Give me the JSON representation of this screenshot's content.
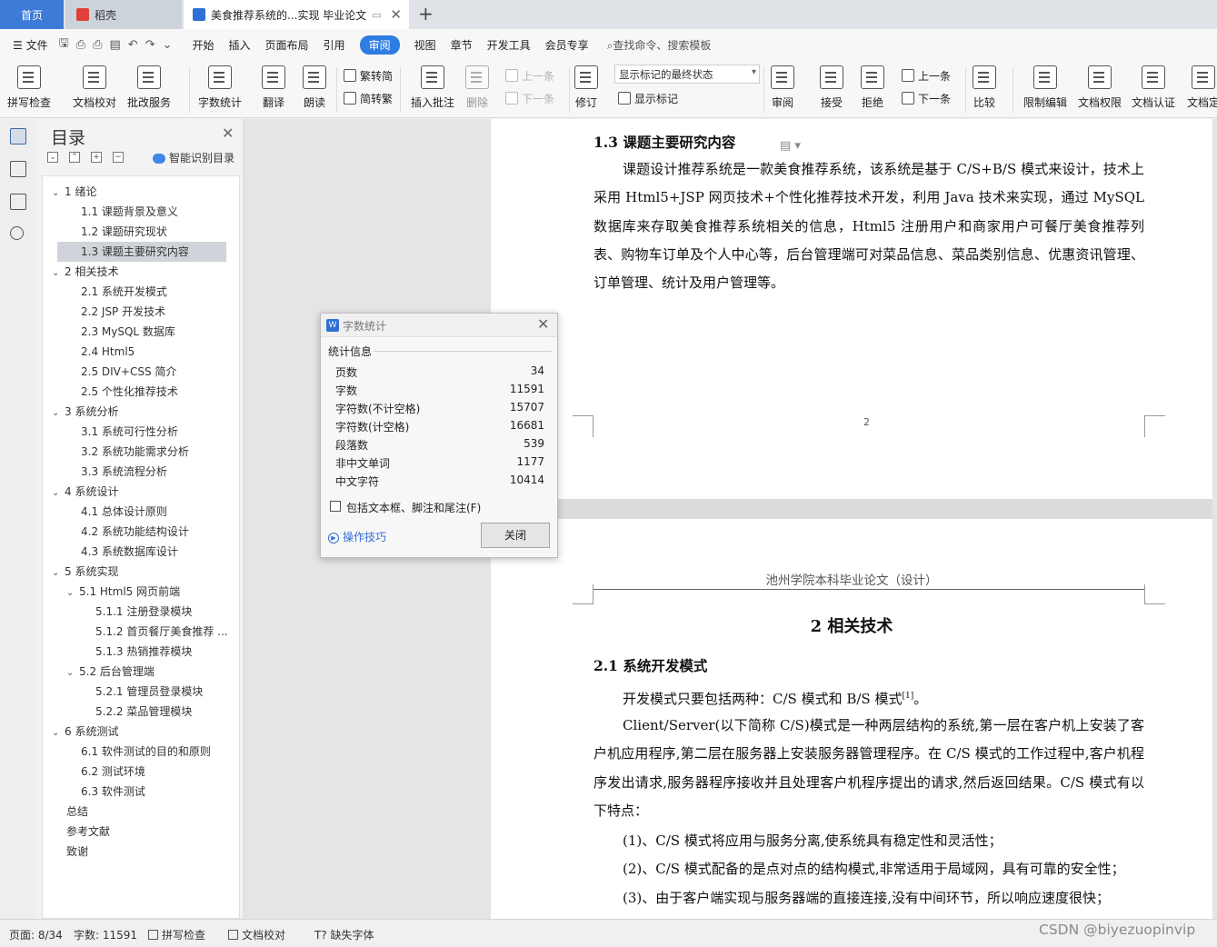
{
  "tabs": {
    "home": "首页",
    "daoke": "稻壳",
    "document": "美食推荐系统的...实现 毕业论文"
  },
  "menu": {
    "file": "文件",
    "items": [
      "开始",
      "插入",
      "页面布局",
      "引用",
      "审阅",
      "视图",
      "章节",
      "开发工具",
      "会员专享"
    ],
    "search": "查找命令、搜索模板"
  },
  "ribbon": {
    "spell_check": "拼写检查",
    "doc_proof": "文档校对",
    "batch_service": "批改服务",
    "word_count": "字数统计",
    "translate": "翻译",
    "read_aloud": "朗读",
    "to_traditional": "繁转简",
    "to_simplified": "简转繁",
    "insert_comment": "插入批注",
    "delete": "删除",
    "prev": "上一条",
    "next": "下一条",
    "track": "修订",
    "markup_state": "显示标记的最终状态",
    "show_markup": "显示标记",
    "review": "审阅",
    "accept": "接受",
    "reject": "拒绝",
    "prev2": "上一条",
    "next2": "下一条",
    "compare": "比较",
    "restrict_edit": "限制编辑",
    "doc_permission": "文档权限",
    "doc_certify": "文档认证",
    "doc_final": "文档定"
  },
  "nav": {
    "title": "目录",
    "smart_toc": "智能识别目录",
    "toc": [
      {
        "label": "1 绪论",
        "level": 1,
        "arrow": "⌄"
      },
      {
        "label": "1.1 课题背景及意义",
        "level": 2
      },
      {
        "label": "1.2 课题研究现状",
        "level": 2
      },
      {
        "label": "1.3 课题主要研究内容",
        "level": 2,
        "selected": true
      },
      {
        "label": "2 相关技术",
        "level": 1,
        "arrow": "⌄"
      },
      {
        "label": "2.1 系统开发模式",
        "level": 2
      },
      {
        "label": "2.2 JSP 开发技术",
        "level": 2
      },
      {
        "label": "2.3 MySQL 数据库",
        "level": 2
      },
      {
        "label": "2.4 Html5",
        "level": 2
      },
      {
        "label": "2.5 DIV+CSS 简介",
        "level": 2
      },
      {
        "label": "2.5 个性化推荐技术",
        "level": 2
      },
      {
        "label": "3 系统分析",
        "level": 1,
        "arrow": "⌄"
      },
      {
        "label": "3.1 系统可行性分析",
        "level": 2
      },
      {
        "label": "3.2 系统功能需求分析",
        "level": 2
      },
      {
        "label": "3.3 系统流程分析",
        "level": 2
      },
      {
        "label": "4 系统设计",
        "level": 1,
        "arrow": "⌄"
      },
      {
        "label": "4.1 总体设计原则",
        "level": 2
      },
      {
        "label": "4.2 系统功能结构设计",
        "level": 2
      },
      {
        "label": "4.3 系统数据库设计",
        "level": 2
      },
      {
        "label": "5  系统实现",
        "level": 1,
        "arrow": "⌄"
      },
      {
        "label": "5.1 Html5 网页前端",
        "level": 2,
        "arrow": "⌄"
      },
      {
        "label": "5.1.1 注册登录模块",
        "level": 3
      },
      {
        "label": "5.1.2 首页餐厅美食推荐 ...",
        "level": 3
      },
      {
        "label": "5.1.3 热销推荐模块",
        "level": 3
      },
      {
        "label": "5.2 后台管理端",
        "level": 2,
        "arrow": "⌄"
      },
      {
        "label": "5.2.1 管理员登录模块",
        "level": 3
      },
      {
        "label": "5.2.2 菜品管理模块",
        "level": 3
      },
      {
        "label": "6  系统测试",
        "level": 1,
        "arrow": "⌄"
      },
      {
        "label": "6.1  软件测试的目的和原则",
        "level": 2
      },
      {
        "label": "6.2  测试环境",
        "level": 2
      },
      {
        "label": "6.3  软件测试",
        "level": 2
      },
      {
        "label": "总结",
        "level": 1
      },
      {
        "label": "参考文献",
        "level": 1
      },
      {
        "label": "致谢",
        "level": 1
      }
    ]
  },
  "document": {
    "page1": {
      "heading": "1.3 课题主要研究内容",
      "paragraph": "课题设计推荐系统是一款美食推荐系统，该系统是基于 C/S+B/S 模式来设计，技术上采用 Html5+JSP 网页技术+个性化推荐技术开发，利用 Java 技术来实现，通过 MySQL 数据库来存取美食推荐系统相关的信息，Html5 注册用户和商家用户可餐厅美食推荐列表、购物车订单及个人中心等，后台管理端可对菜品信息、菜品类别信息、优惠资讯管理、订单管理、统计及用户管理等。",
      "page_number": "2"
    },
    "page2": {
      "header": "池州学院本科毕业论文（设计）",
      "chapter": "2 相关技术",
      "section": "2.1 系统开发模式",
      "p1": "开发模式只要包括两种：C/S 模式和 B/S 模式",
      "p1_ref": "[1]",
      "p1_end": "。",
      "p2": "Client/Server(以下简称 C/S)模式是一种两层结构的系统,第一层在客户机上安装了客户机应用程序,第二层在服务器上安装服务器管理程序。在 C/S 模式的工作过程中,客户机程序发出请求,服务器程序接收并且处理客户机程序提出的请求,然后返回结果。C/S 模式有以下特点：",
      "items": [
        "(1)、C/S 模式将应用与服务分离,使系统具有稳定性和灵活性；",
        "(2)、C/S 模式配备的是点对点的结构模式,非常适用于局域网，具有可靠的安全性；",
        "(3)、由于客户端实现与服务器端的直接连接,没有中间环节，所以响应速度很快；"
      ]
    }
  },
  "dialog": {
    "title": "字数统计",
    "section": "统计信息",
    "stats": [
      {
        "label": "页数",
        "value": "34"
      },
      {
        "label": "字数",
        "value": "11591"
      },
      {
        "label": "字符数(不计空格)",
        "value": "15707"
      },
      {
        "label": "字符数(计空格)",
        "value": "16681"
      },
      {
        "label": "段落数",
        "value": "539"
      },
      {
        "label": "非中文单词",
        "value": "1177"
      },
      {
        "label": "中文字符",
        "value": "10414"
      }
    ],
    "checkbox_label": "包括文本框、脚注和尾注(F)",
    "tips": "操作技巧",
    "close_button": "关闭"
  },
  "status": {
    "page": "页面: 8/34",
    "words": "字数: 11591",
    "spell": "拼写检查",
    "proof": "文档校对",
    "missing_font": "缺失字体"
  },
  "watermark": "CSDN @biyezuopinvip",
  "colors": {
    "accent": "#2f7de1",
    "home_tab": "#3e7bd8"
  }
}
